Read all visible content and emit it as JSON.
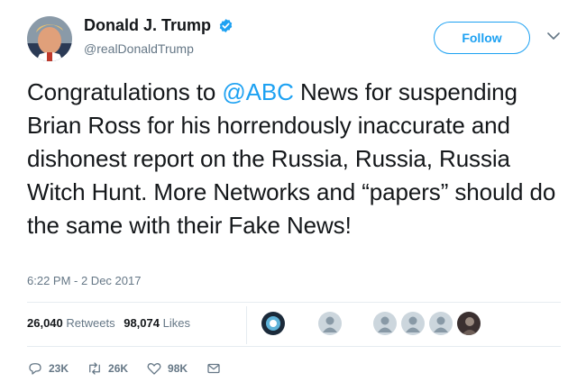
{
  "user": {
    "display_name": "Donald J. Trump",
    "handle": "@realDonaldTrump",
    "verified_icon": "verified-badge-icon"
  },
  "follow_button": {
    "label": "Follow"
  },
  "menu": {
    "icon": "chevron-down-icon"
  },
  "tweet": {
    "text_before": "Congratulations to ",
    "mention": "@ABC",
    "text_after": " News for suspending Brian Ross for his horrendously inaccurate and dishonest report on the Russia, Russia, Russia Witch Hunt. More Networks and “papers” should do the same with their Fake News!",
    "timestamp": "6:22 PM - 2 Dec 2017"
  },
  "stats": {
    "retweets_count": "26,040",
    "retweets_label": "Retweets",
    "likes_count": "98,074",
    "likes_label": "Likes"
  },
  "actions": {
    "reply_count": "23K",
    "retweet_count": "26K",
    "like_count": "98K"
  },
  "colors": {
    "accent": "#1da1f2",
    "text": "#14171a",
    "muted": "#657786",
    "divider": "#e6ecf0"
  }
}
